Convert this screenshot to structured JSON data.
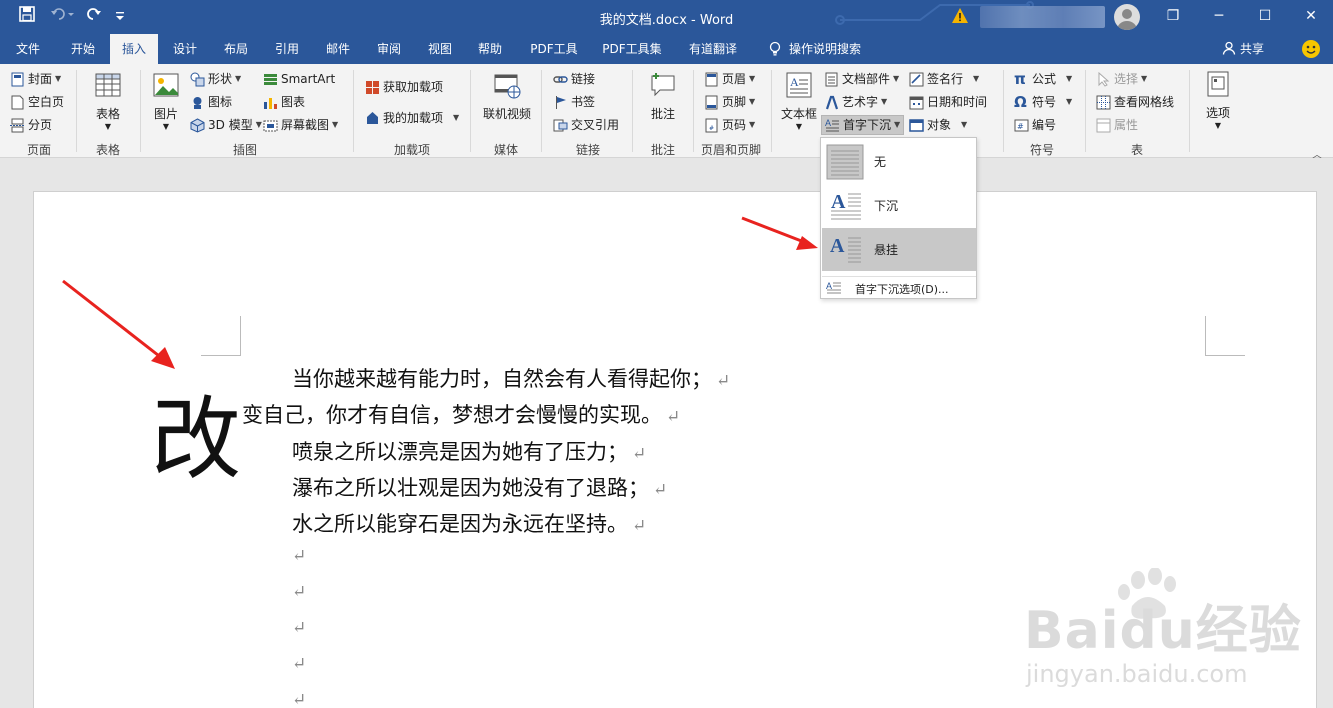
{
  "title_bar": {
    "doc_title": "我的文档.docx  -  Word",
    "restore_label": "❐",
    "minimize_label": "─",
    "maximize_label": "☐",
    "close_label": "✕"
  },
  "tabs": [
    {
      "label": "文件"
    },
    {
      "label": "开始"
    },
    {
      "label": "插入",
      "active": true
    },
    {
      "label": "设计"
    },
    {
      "label": "布局"
    },
    {
      "label": "引用"
    },
    {
      "label": "邮件"
    },
    {
      "label": "审阅"
    },
    {
      "label": "视图"
    },
    {
      "label": "帮助"
    },
    {
      "label": "PDF工具"
    },
    {
      "label": "PDF工具集"
    },
    {
      "label": "有道翻译"
    },
    {
      "label": "操作说明搜索"
    }
  ],
  "share_label": "共享",
  "ribbon": {
    "groups": {
      "pages": "页面",
      "tables": "表格",
      "illustrations": "插图",
      "addins": "加载项",
      "media": "媒体",
      "links": "链接",
      "comments": "批注",
      "header_footer": "页眉和页脚",
      "symbols": "符号",
      "table2": "表"
    },
    "cover": "封面",
    "blank_page": "空白页",
    "page_break": "分页",
    "table": "表格",
    "picture": "图片",
    "shapes": "形状",
    "icons": "图标",
    "model_3d": "3D 模型",
    "smartart": "SmartArt",
    "chart": "图表",
    "screenshot": "屏幕截图",
    "get_addins": "获取加载项",
    "my_addins": "我的加载项",
    "online_video": "联机视频",
    "link": "链接",
    "bookmark": "书签",
    "cross_ref": "交叉引用",
    "comment": "批注",
    "header": "页眉",
    "footer": "页脚",
    "page_number": "页码",
    "textbox": "文本框",
    "quick_parts": "文档部件",
    "wordart": "艺术字",
    "drop_cap": "首字下沉",
    "signature_line": "签名行",
    "date_time": "日期和时间",
    "object": "对象",
    "equation": "公式",
    "symbol": "符号",
    "numbering": "编号",
    "select": "选择",
    "view_gridlines": "查看网格线",
    "properties": "属性",
    "options": "选项"
  },
  "dropcap_menu": {
    "none": "无",
    "dropped": "下沉",
    "in_margin": "悬挂",
    "options": "首字下沉选项(D)..."
  },
  "document": {
    "drop_cap_char": "改",
    "lines": [
      "当你越来越有能力时，自然会有人看得起你；",
      "变自己，你才有自信，梦想才会慢慢的实现。",
      "喷泉之所以漂亮是因为她有了压力；",
      "瀑布之所以壮观是因为她没有了退路；",
      "水之所以能穿石是因为永远在坚持。"
    ],
    "para_mark": "↵"
  },
  "watermark": {
    "brand": "Baidu经验",
    "url": "jingyan.baidu.com"
  },
  "colors": {
    "title_bar": "#2b579a",
    "ribbon_bg": "#f3f3f3",
    "selected_menu_item": "#c8c8c8",
    "arrow": "#e8231f"
  }
}
